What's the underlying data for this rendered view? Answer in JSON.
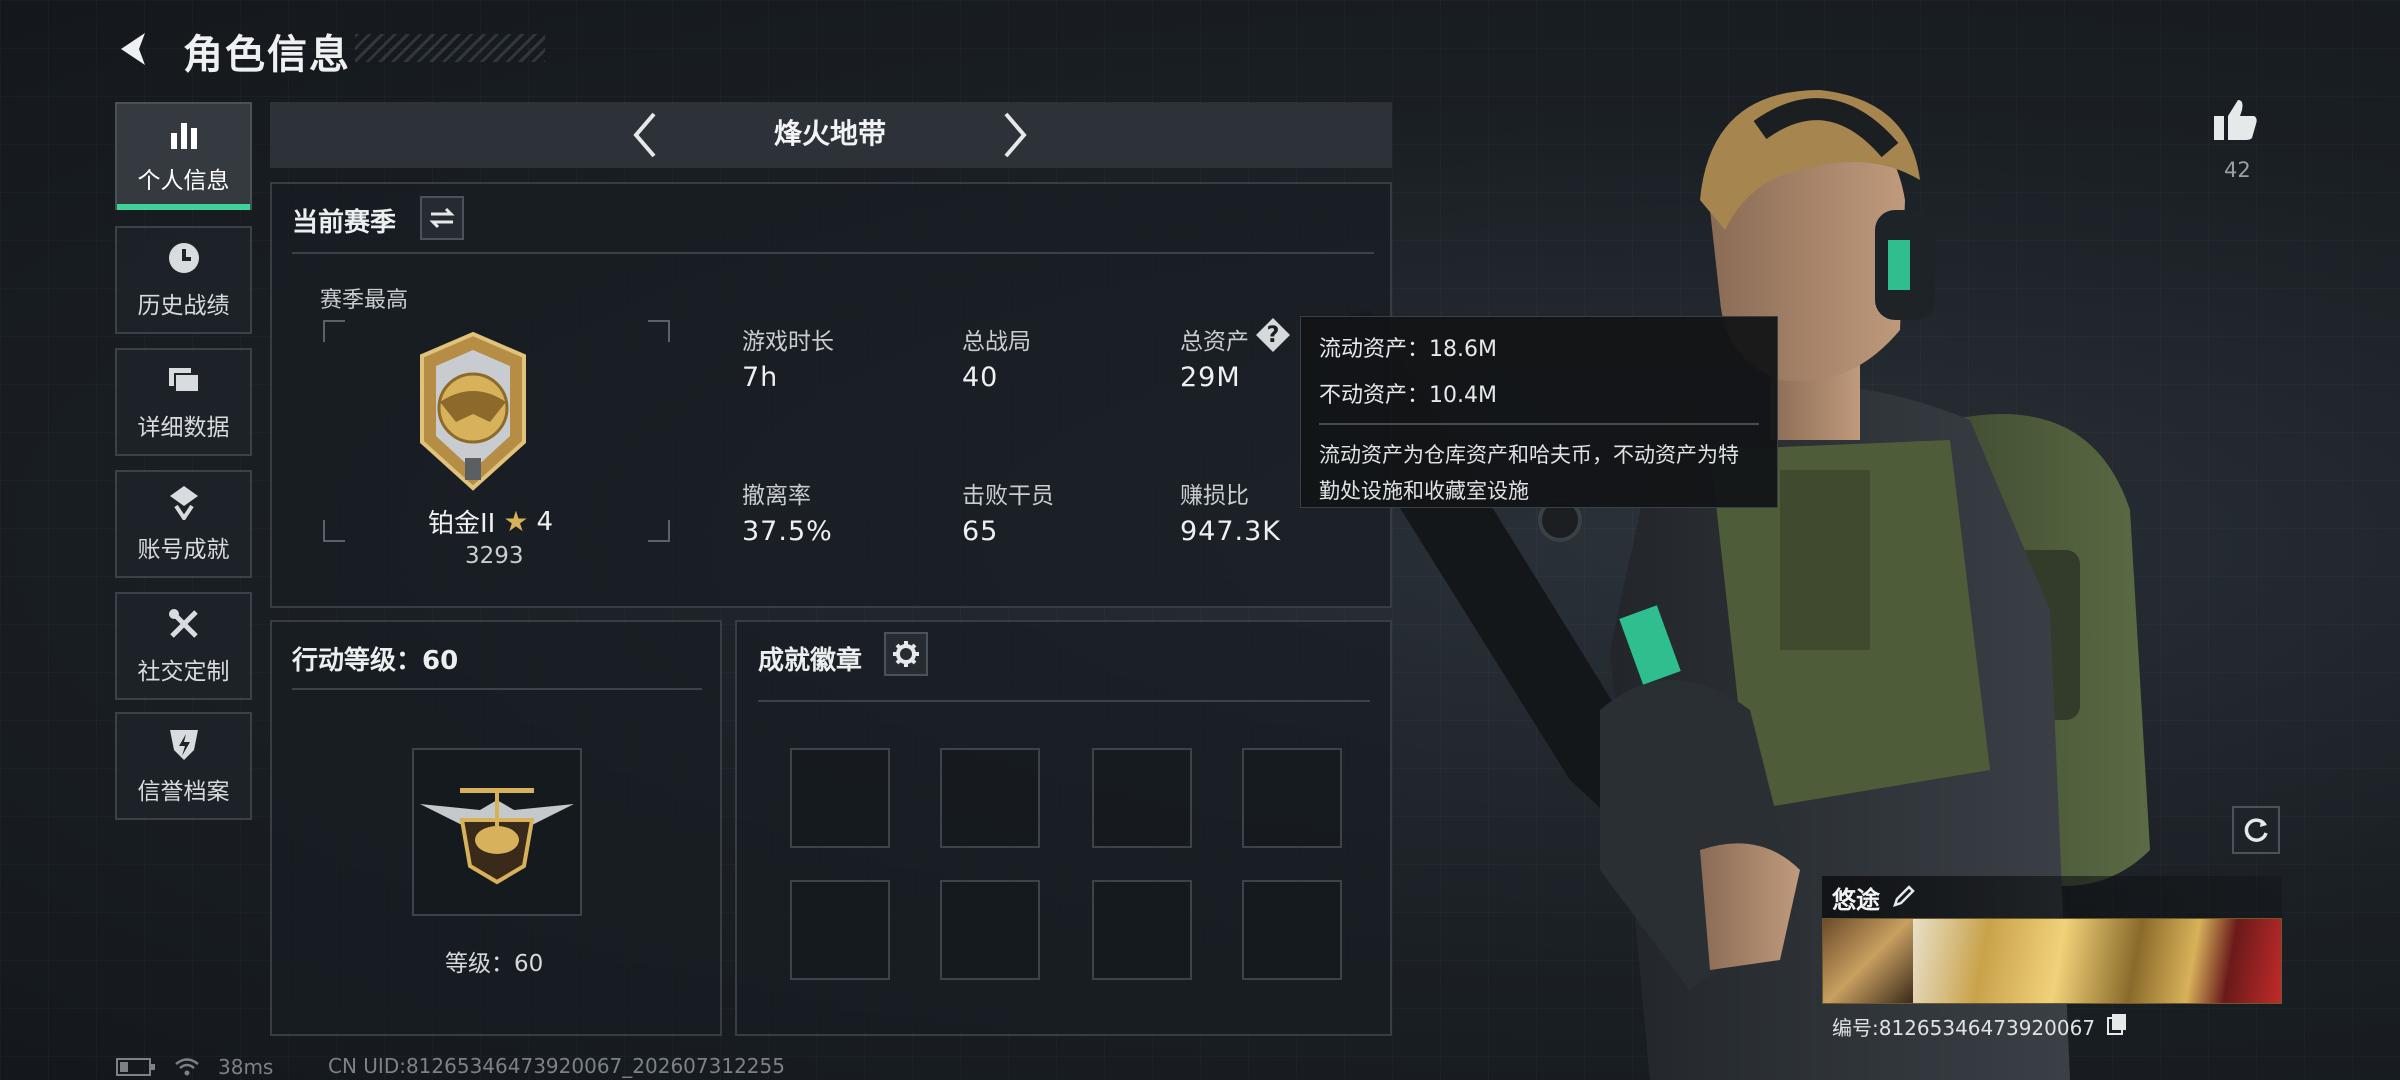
{
  "header": {
    "title": "角色信息"
  },
  "nav": {
    "items": [
      {
        "label": "个人信息",
        "icon": "bar-chart-icon",
        "active": true
      },
      {
        "label": "历史战绩",
        "icon": "clock-icon",
        "active": false
      },
      {
        "label": "详细数据",
        "icon": "folder-icon",
        "active": false
      },
      {
        "label": "账号成就",
        "icon": "achievement-icon",
        "active": false
      },
      {
        "label": "社交定制",
        "icon": "tools-icon",
        "active": false
      },
      {
        "label": "信誉档案",
        "icon": "shield-bolt-icon",
        "active": false
      }
    ]
  },
  "mode": {
    "title": "烽火地带"
  },
  "season": {
    "title": "当前赛季",
    "best_label": "赛季最高",
    "rank_name": "铂金II",
    "rank_stars": "4",
    "rank_score": "3293",
    "stats": [
      {
        "label": "游戏时长",
        "value": "7h"
      },
      {
        "label": "总战局",
        "value": "40"
      },
      {
        "label": "总资产",
        "value": "29M"
      },
      {
        "label": "撤离率",
        "value": "37.5%"
      },
      {
        "label": "击败干员",
        "value": "65"
      },
      {
        "label": "赚损比",
        "value": "947.3K"
      }
    ]
  },
  "tooltip": {
    "liquid": "流动资产：18.6M",
    "fixed": "不动资产：10.4M",
    "desc": "流动资产为仓库资产和哈夫币，不动资产为特勤处设施和收藏室设施"
  },
  "action_level": {
    "title": "行动等级：60",
    "level_text": "等级：60"
  },
  "badges": {
    "title": "成就徽章",
    "slots": 8
  },
  "likes": {
    "count": "42"
  },
  "player": {
    "name": "悠途",
    "id_text": "编号:81265346473920067"
  },
  "status_bar": {
    "ping": "38ms",
    "uid": "CN UID:81265346473920067_202607312255"
  },
  "colors": {
    "accent": "#3fd39a",
    "gold": "#d8b25a"
  }
}
